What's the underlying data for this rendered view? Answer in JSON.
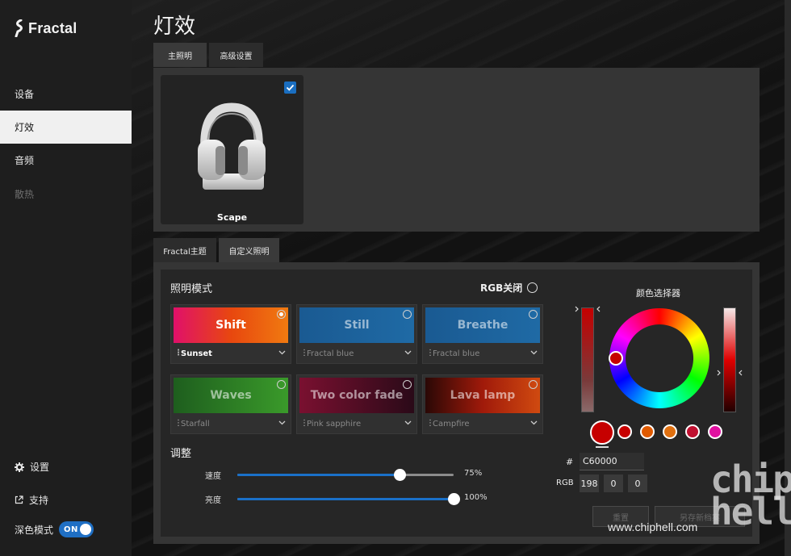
{
  "brand": {
    "name": "Fractal"
  },
  "sidebar": {
    "items": [
      {
        "label": "设备",
        "state": "normal"
      },
      {
        "label": "灯效",
        "state": "active"
      },
      {
        "label": "音频",
        "state": "normal"
      },
      {
        "label": "散热",
        "state": "disabled"
      }
    ],
    "settings_label": "设置",
    "support_label": "支持",
    "dark_mode_label": "深色模式",
    "dark_mode_toggle": "ON"
  },
  "page": {
    "title": "灯效",
    "top_tabs": [
      {
        "label": "主照明",
        "active": true
      },
      {
        "label": "高级设置",
        "active": false
      }
    ],
    "device": {
      "name": "Scape",
      "checked": true
    },
    "lighting_tabs": [
      {
        "label": "Fractal主题",
        "active": false
      },
      {
        "label": "自定义照明",
        "active": true
      }
    ]
  },
  "lighting": {
    "mode_title": "照明模式",
    "rgb_off_label": "RGB关闭",
    "modes": [
      {
        "name": "Shift",
        "preset": "Sunset",
        "selected": true,
        "colors": [
          "#e0106a",
          "#e8470f",
          "#f07a10"
        ]
      },
      {
        "name": "Still",
        "preset": "Fractal blue",
        "selected": false,
        "colors": [
          "#1a5a92",
          "#1f6aa5"
        ]
      },
      {
        "name": "Breathe",
        "preset": "Fractal blue",
        "selected": false,
        "colors": [
          "#1a5a92",
          "#1f6aa5"
        ]
      },
      {
        "name": "Waves",
        "preset": "Starfall",
        "selected": false,
        "colors": [
          "#1e5e1e",
          "#3a9a2a"
        ]
      },
      {
        "name": "Two color fade",
        "preset": "Pink sapphire",
        "selected": false,
        "colors": [
          "#7a1030",
          "#2a0a18"
        ]
      },
      {
        "name": "Lava lamp",
        "preset": "Campfire",
        "selected": false,
        "colors": [
          "#2a0806",
          "#a01a0a",
          "#d04a10"
        ]
      }
    ],
    "adjust_title": "调整",
    "sliders": [
      {
        "label": "速度",
        "value": 0.75,
        "display": "75%"
      },
      {
        "label": "亮度",
        "value": 1.0,
        "display": "100%"
      }
    ]
  },
  "color_picker": {
    "title": "颜色选择器",
    "hex_label": "#",
    "hex_value": "C60000",
    "rgb_label": "RGB",
    "rgb": [
      "198",
      "0",
      "0"
    ],
    "current_color": "#c60000",
    "presets": [
      "#c80000",
      "#e05a00",
      "#e07010",
      "#c01030",
      "#e010a0"
    ],
    "reset_label": "重置",
    "save_label": "另存新档案"
  },
  "watermark": {
    "url": "www.chiphell.com",
    "logo": "chip hell"
  }
}
